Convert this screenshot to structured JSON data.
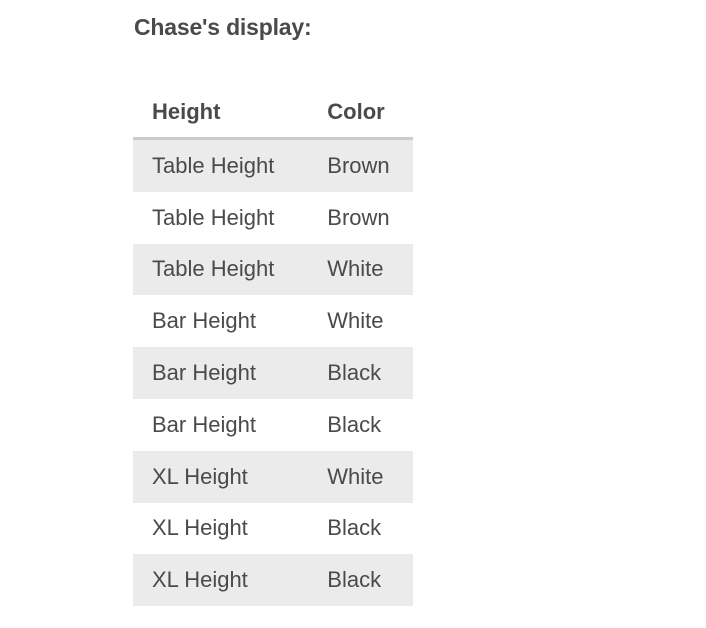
{
  "title": "Chase's display:",
  "table": {
    "headers": [
      "Height",
      "Color"
    ],
    "rows": [
      [
        "Table Height",
        "Brown"
      ],
      [
        "Table Height",
        "Brown"
      ],
      [
        "Table Height",
        "White"
      ],
      [
        "Bar Height",
        "White"
      ],
      [
        "Bar Height",
        "Black"
      ],
      [
        "Bar Height",
        "Black"
      ],
      [
        "XL Height",
        "White"
      ],
      [
        "XL Height",
        "Black"
      ],
      [
        "XL Height",
        "Black"
      ]
    ]
  }
}
